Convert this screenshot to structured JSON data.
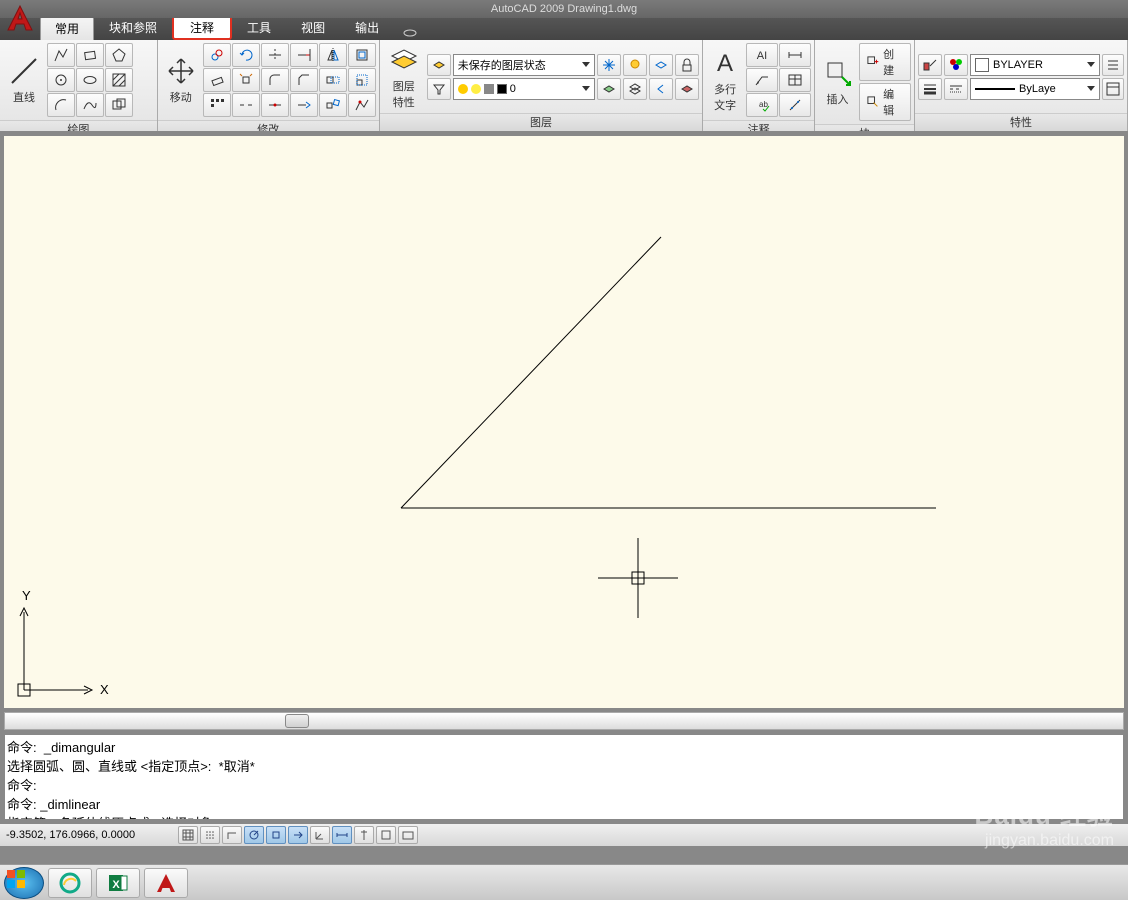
{
  "app": {
    "title": "AutoCAD 2009 Drawing1.dwg"
  },
  "tabs": {
    "items": [
      "常用",
      "块和参照",
      "注释",
      "工具",
      "视图",
      "输出"
    ],
    "active_index": 0,
    "highlighted_index": 2
  },
  "panels": {
    "draw": {
      "title": "绘图",
      "line_label": "直线"
    },
    "modify": {
      "title": "修改",
      "move_label": "移动"
    },
    "layer": {
      "title": "图层",
      "props_label": "图层\n特性",
      "state_dropdown": "未保存的图层状态",
      "layer_dropdown": "0"
    },
    "annotate": {
      "title": "注释",
      "mtext_label": "多行\n文字"
    },
    "block": {
      "title": "块",
      "insert_label": "插入",
      "create": "创建",
      "edit": "编辑"
    },
    "properties": {
      "title": "特性",
      "color_dropdown": "BYLAYER",
      "linetype_dropdown": "ByLaye"
    }
  },
  "command_window": {
    "lines": [
      "命令:  _dimangular",
      "选择圆弧、圆、直线或 <指定顶点>:  *取消*",
      "命令: ",
      "命令: _dimlinear",
      "指定第一条延伸线原点或 <选择对象>:"
    ]
  },
  "status": {
    "coords": "-9.3502,  176.0966,  0.0000"
  },
  "ucs": {
    "x": "X",
    "y": "Y"
  },
  "watermark": {
    "brand": "Baidu 经验",
    "url": "jingyan.baidu.com"
  }
}
